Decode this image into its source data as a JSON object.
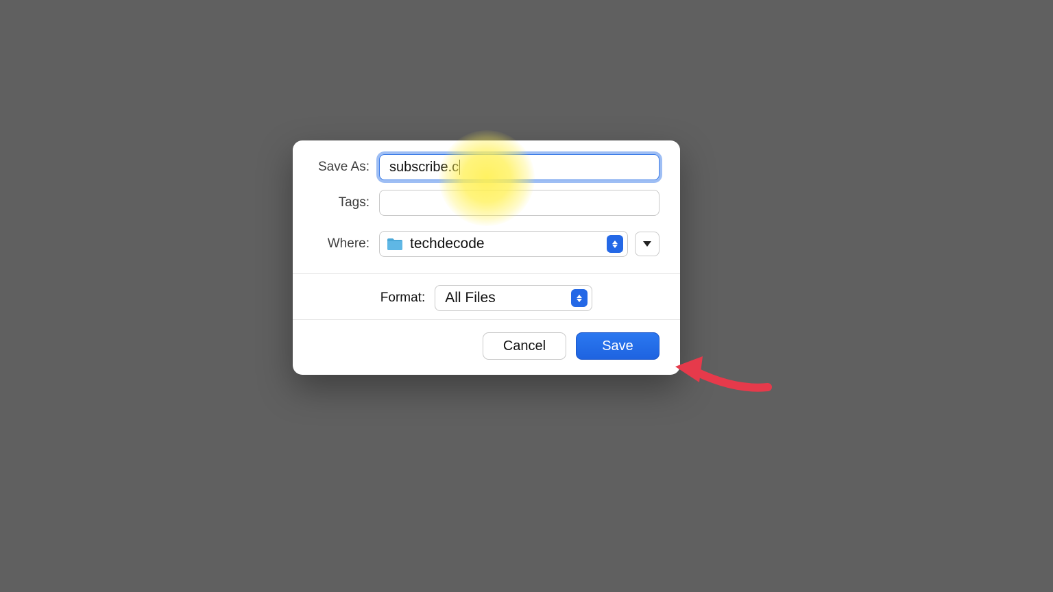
{
  "labels": {
    "save_as": "Save As:",
    "tags": "Tags:",
    "where": "Where:",
    "format": "Format:"
  },
  "save_as": {
    "value": "subscribe.c"
  },
  "tags": {
    "value": ""
  },
  "where": {
    "folder": "techdecode"
  },
  "format": {
    "value": "All Files"
  },
  "buttons": {
    "cancel": "Cancel",
    "save": "Save"
  },
  "colors": {
    "accent": "#2468e6",
    "focus_ring": "#3f7ee8",
    "arrow": "#e63a4b"
  }
}
